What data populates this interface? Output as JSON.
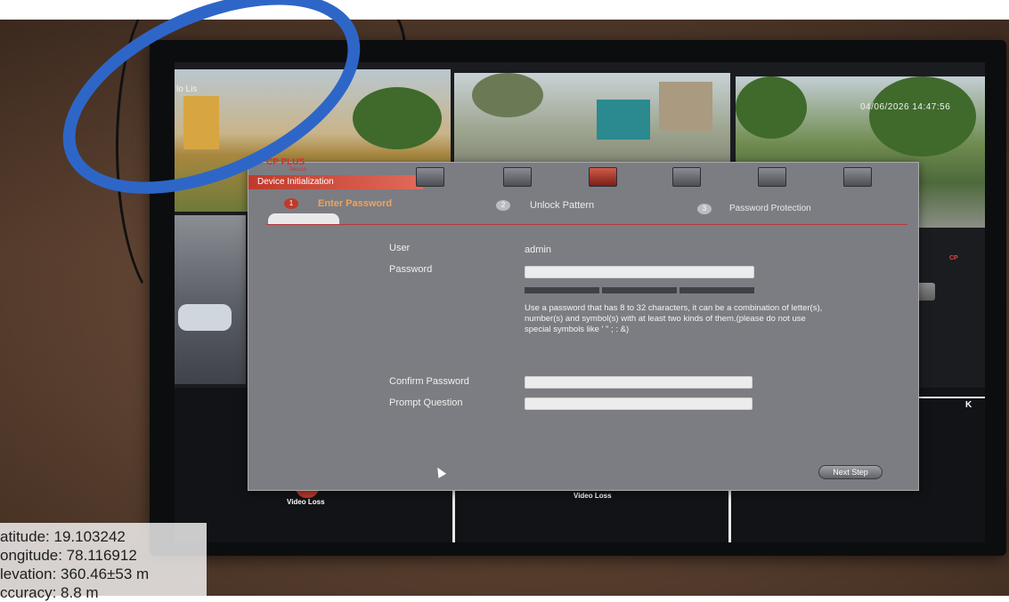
{
  "camera": {
    "timestamp": "04/06/2026 14:47:56",
    "channel_label": "lo Lis",
    "video_loss_label": "Video Loss"
  },
  "dialog": {
    "brand": "CP PLUS",
    "brand_sub": "Secure",
    "title": "Device Initialization",
    "steps": [
      {
        "number": "1",
        "label": "Enter Password",
        "active": true
      },
      {
        "number": "2",
        "label": "Unlock Pattern",
        "active": false
      },
      {
        "number": "3",
        "label": "Password Protection",
        "active": false
      }
    ],
    "fields": {
      "user_label": "User",
      "user_value": "admin",
      "password_label": "Password",
      "password_value": "",
      "confirm_label": "Confirm Password",
      "confirm_value": "",
      "prompt_label": "Prompt Question",
      "prompt_value": ""
    },
    "hint": "Use a password that has 8 to 32 characters, it can be a combination of letter(s), number(s) and symbol(s) with at least two kinds of them.(please do not use special symbols like ' \" ; : &)",
    "next_label": "Next Step"
  },
  "geo": {
    "latitude": "atitude: 19.103242",
    "longitude": "ongitude: 78.116912",
    "elevation": "levation: 360.46±53 m",
    "accuracy": "ccuracy: 8.8 m"
  },
  "colors": {
    "accent_red": "#c0392b",
    "active_step": "#f0a35a",
    "scribble_blue": "#2e66c8"
  }
}
